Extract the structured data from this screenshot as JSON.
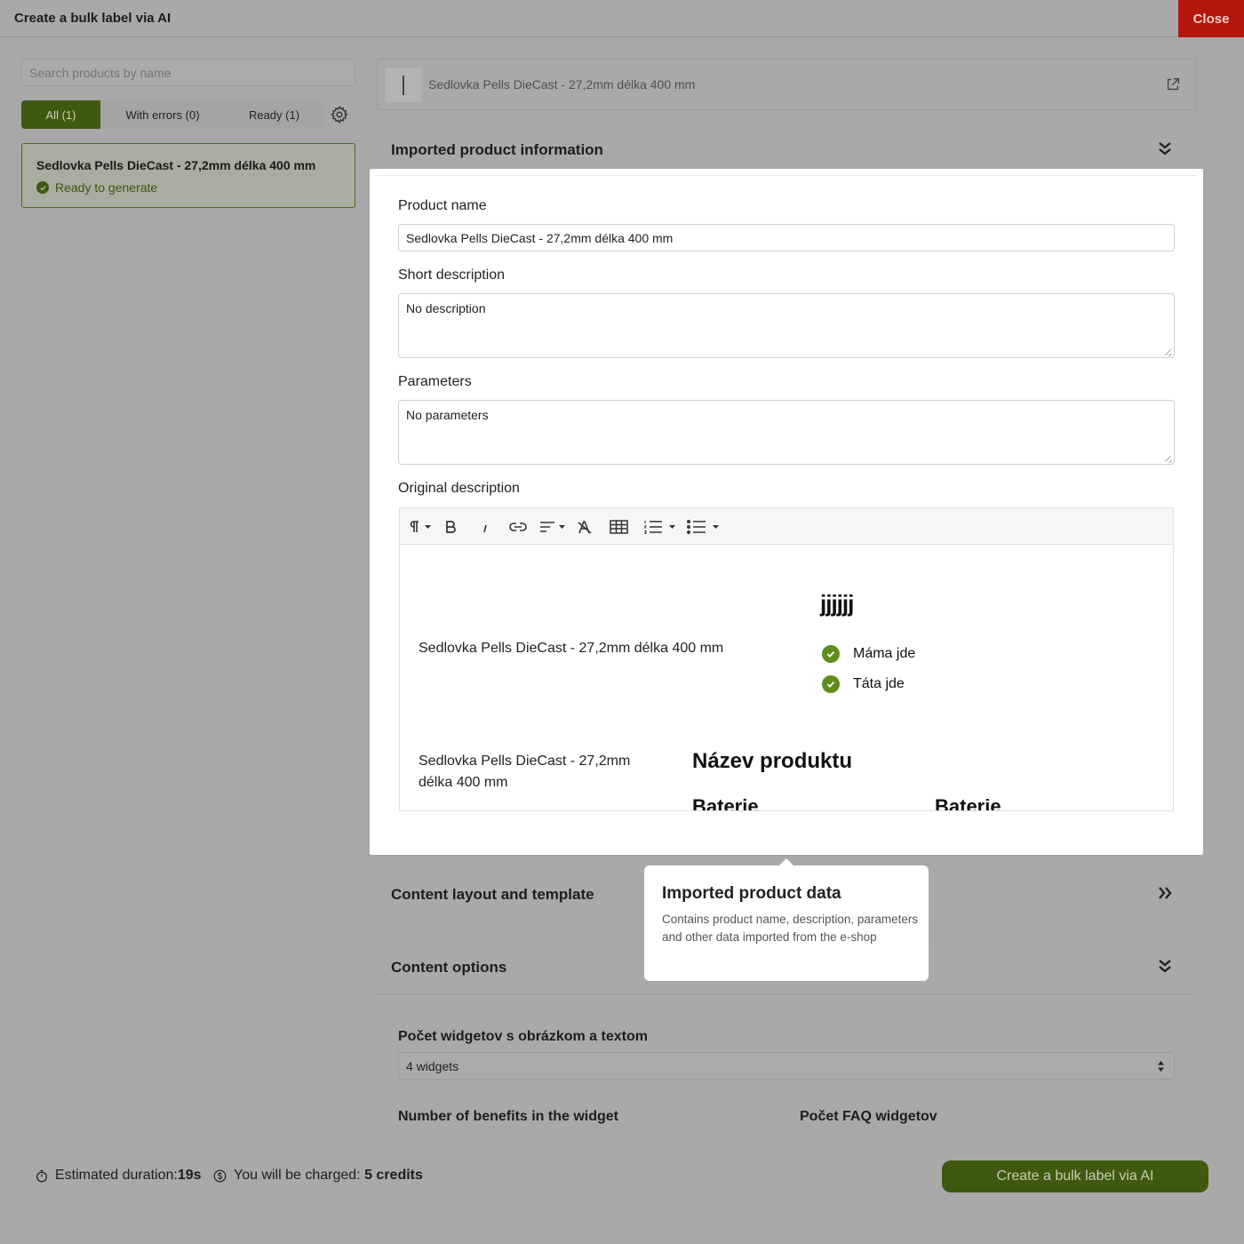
{
  "header": {
    "title": "Create a bulk label via AI",
    "close_label": "Close"
  },
  "sidebar": {
    "search_placeholder": "Search products by name",
    "tabs": [
      {
        "label": "All (1)"
      },
      {
        "label": "With errors (0)"
      },
      {
        "label": "Ready (1)"
      }
    ],
    "products": [
      {
        "name": "Sedlovka Pells DieCast - 27,2mm délka 400 mm",
        "status": "Ready to generate"
      }
    ]
  },
  "product_bar": {
    "name": "Sedlovka Pells DieCast - 27,2mm délka 400 mm"
  },
  "imported_section": {
    "title": "Imported product information",
    "product_name_label": "Product name",
    "product_name_value": "Sedlovka Pells DieCast - 27,2mm délka 400 mm",
    "short_desc_label": "Short description",
    "short_desc_value": "No description",
    "parameters_label": "Parameters",
    "parameters_value": "No parameters",
    "original_desc_label": "Original description",
    "editor": {
      "image_alt_1": "Sedlovka Pells DieCast - 27,2mm délka 400 mm",
      "heading": "jjjjjj",
      "benefits": [
        "Máma jde",
        "Táta jde"
      ],
      "image_alt_2": "Sedlovka Pells DieCast - 27,2mm délka 400 mm",
      "product_title": "Název produktu",
      "col1": "Baterie",
      "col2": "Baterie"
    }
  },
  "tooltip": {
    "title": "Imported product data",
    "text": "Contains product name, description, parameters and other data imported from the e-shop"
  },
  "layout_section": {
    "title": "Content layout and template"
  },
  "options_section": {
    "title": "Content options",
    "widget_count_label": "Počet widgetov s obrázkom a textom",
    "widget_count_value": "4 widgets",
    "benefits_label": "Number of benefits in the widget",
    "faq_label": "Počet FAQ widgetov"
  },
  "footer": {
    "duration_label": "Estimated duration:",
    "duration_value": "19s",
    "charge_label": "You will be charged:",
    "charge_value": "5 credits",
    "create_label": "Create a bulk label via AI"
  },
  "colors": {
    "accent": "#3f5a10",
    "close": "#b5160c",
    "check": "#5f8d1d"
  }
}
